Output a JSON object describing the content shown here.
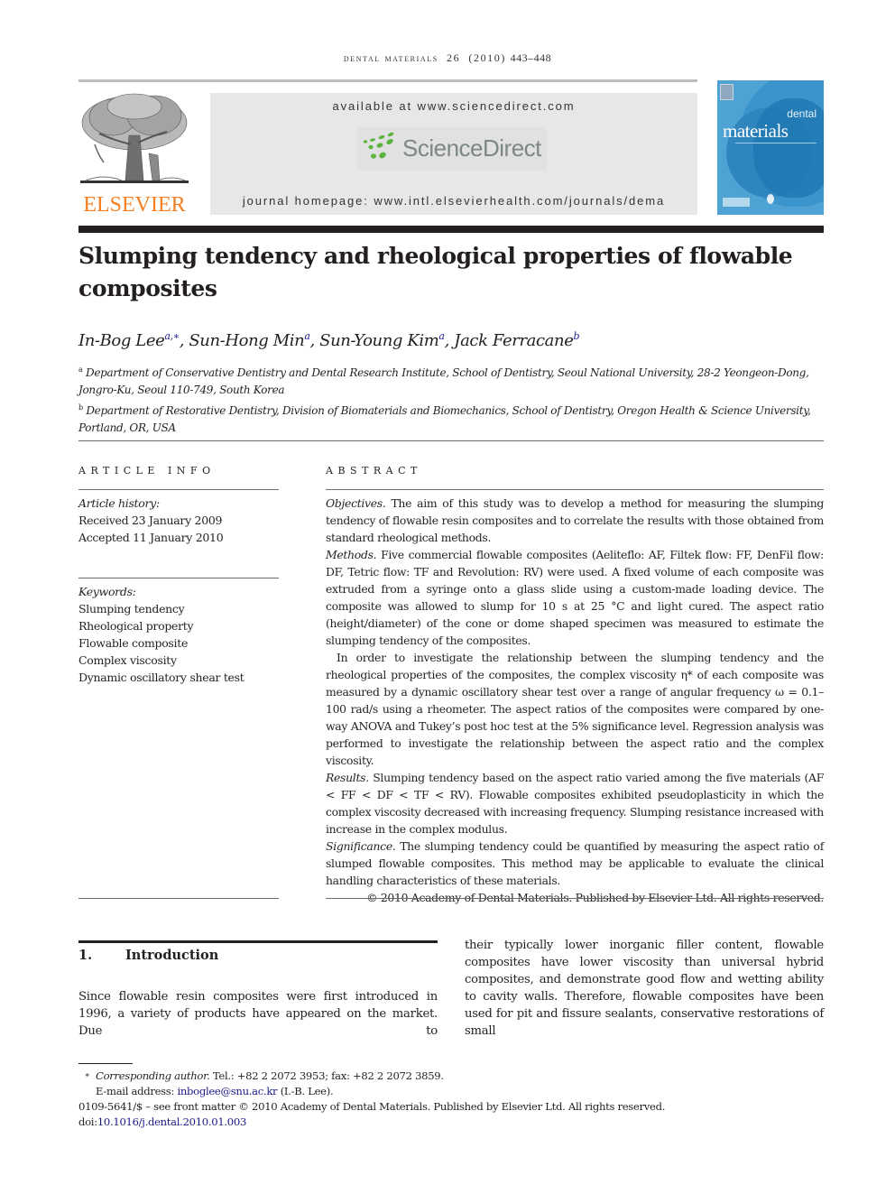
{
  "running_head": {
    "journal": "dental materials",
    "volume": "26",
    "year": "(2010)",
    "pages": "443–448"
  },
  "header": {
    "publisher_logo_text": "ELSEVIER",
    "available_at": "available at www.sciencedirect.com",
    "sciencedirect_logo_text": "ScienceDirect",
    "journal_homepage": "journal homepage: www.intl.elsevierhealth.com/journals/dema",
    "cover": {
      "title_top": "dental",
      "title_main": "materials"
    },
    "colors": {
      "elsevier_orange": "#f47e20",
      "sciencedirect_green": "#5ab33b",
      "sciencedirect_grey": "#7d8885",
      "banner_grey": "#e7e7e7",
      "cover_blue": "#4fa3d4",
      "link_blue": "#1a1a8a"
    }
  },
  "article": {
    "title": "Slumping tendency and rheological properties of flowable composites",
    "authors": [
      {
        "name": "In-Bog Lee",
        "sup": "a,∗",
        "sep": ", "
      },
      {
        "name": "Sun-Hong Min",
        "sup": "a",
        "sep": ", "
      },
      {
        "name": "Sun-Young Kim",
        "sup": "a",
        "sep": ", "
      },
      {
        "name": "Jack Ferracane",
        "sup": "b",
        "sep": ""
      }
    ],
    "affiliations": [
      {
        "mark": "a",
        "text": "Department of Conservative Dentistry and Dental Research Institute, School of Dentistry, Seoul National University, 28-2 Yeongeon-Dong, Jongro-Ku, Seoul 110-749, South Korea"
      },
      {
        "mark": "b",
        "text": "Department of Restorative Dentistry, Division of Biomaterials and Biomechanics, School of Dentistry, Oregon Health & Science University, Portland, OR, USA"
      }
    ]
  },
  "article_info": {
    "heading": "ARTICLE INFO",
    "history_label": "Article history:",
    "received": "Received 23 January 2009",
    "accepted": "Accepted 11 January 2010",
    "keywords_label": "Keywords:",
    "keywords": [
      "Slumping tendency",
      "Rheological property",
      "Flowable composite",
      "Complex viscosity",
      "Dynamic oscillatory shear test"
    ]
  },
  "abstract": {
    "heading": "ABSTRACT",
    "objectives_label": "Objectives.",
    "objectives": " The aim of this study was to develop a method for measuring the slumping tendency of flowable resin composites and to correlate the results with those obtained from standard rheological methods.",
    "methods_label": "Methods.",
    "methods": " Five commercial flowable composites (Aeliteflo: AF, Filtek flow: FF, DenFil flow: DF, Tetric flow: TF and Revolution: RV) were used. A fixed volume of each composite was extruded from a syringe onto a glass slide using a custom-made loading device. The composite was allowed to slump for 10 s at 25 °C and light cured. The aspect ratio (height/diameter) of the cone or dome shaped specimen was measured to estimate the slumping tendency of the composites.",
    "methods_2": "In order to investigate the relationship between the slumping tendency and the rheological properties of the composites, the complex viscosity η* of each composite was measured by a dynamic oscillatory shear test over a range of angular frequency ω = 0.1–100 rad/s using a rheometer. The aspect ratios of the composites were compared by one-way ANOVA and Tukey’s post hoc test at the 5% significance level. Regression analysis was performed to investigate the relationship between the aspect ratio and the complex viscosity.",
    "results_label": "Results.",
    "results": " Slumping tendency based on the aspect ratio varied among the five materials (AF < FF < DF < TF < RV). Flowable composites exhibited pseudoplasticity in which the complex viscosity decreased with increasing frequency. Slumping resistance increased with increase in the complex modulus.",
    "significance_label": "Significance.",
    "significance": " The slumping tendency could be quantified by measuring the aspect ratio of slumped flowable composites. This method may be applicable to evaluate the clinical handling characteristics of these materials.",
    "copyright": "© 2010 Academy of Dental Materials. Published by Elsevier Ltd. All rights reserved."
  },
  "introduction": {
    "number": "1.",
    "heading": "Introduction",
    "left_text": "Since flowable resin composites were first introduced in 1996, a variety of products have appeared on the market. Due to",
    "right_text": "their typically lower inorganic filler content, flowable composites have lower viscosity than universal hybrid composites, and demonstrate good flow and wetting ability to cavity walls. Therefore, flowable composites have been used for pit and fissure sealants, conservative restorations of small"
  },
  "footnotes": {
    "asterisk": "∗",
    "corresponding_label": "Corresponding author.",
    "contact": " Tel.: +82 2 2072 3953; fax: +82 2 2072 3859.",
    "email_label": "E-mail address: ",
    "email": "inboglee@snu.ac.kr",
    "email_suffix": " (I.-B. Lee).",
    "front_matter": "0109-5641/$ – see front matter © 2010 Academy of Dental Materials. Published by Elsevier Ltd. All rights reserved.",
    "doi_label": "doi:",
    "doi": "10.1016/j.dental.2010.01.003"
  }
}
